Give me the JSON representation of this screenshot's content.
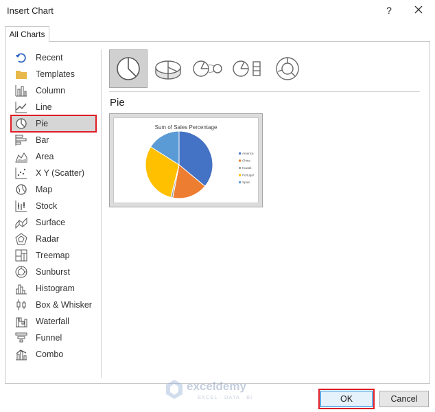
{
  "window": {
    "title": "Insert Chart",
    "help_label": "?"
  },
  "tabs": [
    {
      "label": "All Charts"
    }
  ],
  "sidebar": {
    "items": [
      {
        "label": "Recent",
        "icon": "recent-icon"
      },
      {
        "label": "Templates",
        "icon": "folder-icon"
      },
      {
        "label": "Column",
        "icon": "column-chart-icon"
      },
      {
        "label": "Line",
        "icon": "line-chart-icon"
      },
      {
        "label": "Pie",
        "icon": "pie-chart-icon",
        "selected": true
      },
      {
        "label": "Bar",
        "icon": "bar-chart-icon"
      },
      {
        "label": "Area",
        "icon": "area-chart-icon"
      },
      {
        "label": "X Y (Scatter)",
        "icon": "scatter-chart-icon"
      },
      {
        "label": "Map",
        "icon": "map-chart-icon"
      },
      {
        "label": "Stock",
        "icon": "stock-chart-icon"
      },
      {
        "label": "Surface",
        "icon": "surface-chart-icon"
      },
      {
        "label": "Radar",
        "icon": "radar-chart-icon"
      },
      {
        "label": "Treemap",
        "icon": "treemap-chart-icon"
      },
      {
        "label": "Sunburst",
        "icon": "sunburst-chart-icon"
      },
      {
        "label": "Histogram",
        "icon": "histogram-chart-icon"
      },
      {
        "label": "Box & Whisker",
        "icon": "box-whisker-chart-icon"
      },
      {
        "label": "Waterfall",
        "icon": "waterfall-chart-icon"
      },
      {
        "label": "Funnel",
        "icon": "funnel-chart-icon"
      },
      {
        "label": "Combo",
        "icon": "combo-chart-icon"
      }
    ]
  },
  "main": {
    "subtypes": [
      {
        "icon": "pie-icon",
        "selected": true
      },
      {
        "icon": "3d-pie-icon"
      },
      {
        "icon": "pie-of-pie-icon"
      },
      {
        "icon": "bar-of-pie-icon"
      },
      {
        "icon": "doughnut-icon"
      }
    ],
    "selected_type_label": "Pie"
  },
  "chart_data": {
    "type": "pie",
    "title": "Sum of Sales Percentage",
    "categories": [
      "America",
      "China",
      "Kuwait",
      "Portugal",
      "Spain"
    ],
    "values": [
      36,
      17,
      1,
      30,
      16
    ],
    "colors": [
      "#4472c4",
      "#ed7d31",
      "#a5a5a5",
      "#ffc000",
      "#5b9bd5"
    ],
    "legend_position": "right"
  },
  "footer": {
    "ok_label": "OK",
    "cancel_label": "Cancel"
  },
  "watermark": {
    "brand": "exceldemy",
    "tagline": "EXCEL · DATA · BI"
  },
  "colors": {
    "highlight": "#e01b24",
    "selected_bg": "#d6d6d6"
  }
}
